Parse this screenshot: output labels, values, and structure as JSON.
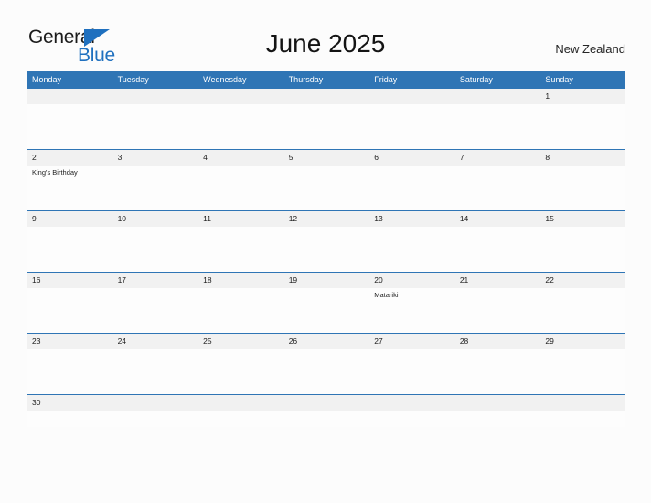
{
  "brand": {
    "word_primary": "General",
    "word_secondary": "Blue",
    "flag_icon": "blue-flag-triangle",
    "primary_color": "#1b1b1b",
    "secondary_color": "#1f70bf"
  },
  "header": {
    "title": "June 2025",
    "region": "New Zealand",
    "accent_color": "#2f75b5"
  },
  "calendar": {
    "month": "June",
    "year": "2025",
    "weekday_headers": [
      "Monday",
      "Tuesday",
      "Wednesday",
      "Thursday",
      "Friday",
      "Saturday",
      "Sunday"
    ],
    "header_background": "#2f75b5",
    "number_band_background": "#f1f1f1",
    "weeks": [
      {
        "days": [
          {
            "number": "",
            "events": []
          },
          {
            "number": "",
            "events": []
          },
          {
            "number": "",
            "events": []
          },
          {
            "number": "",
            "events": []
          },
          {
            "number": "",
            "events": []
          },
          {
            "number": "",
            "events": []
          },
          {
            "number": "1",
            "events": []
          }
        ]
      },
      {
        "days": [
          {
            "number": "2",
            "events": [
              "King's Birthday"
            ]
          },
          {
            "number": "3",
            "events": []
          },
          {
            "number": "4",
            "events": []
          },
          {
            "number": "5",
            "events": []
          },
          {
            "number": "6",
            "events": []
          },
          {
            "number": "7",
            "events": []
          },
          {
            "number": "8",
            "events": []
          }
        ]
      },
      {
        "days": [
          {
            "number": "9",
            "events": []
          },
          {
            "number": "10",
            "events": []
          },
          {
            "number": "11",
            "events": []
          },
          {
            "number": "12",
            "events": []
          },
          {
            "number": "13",
            "events": []
          },
          {
            "number": "14",
            "events": []
          },
          {
            "number": "15",
            "events": []
          }
        ]
      },
      {
        "days": [
          {
            "number": "16",
            "events": []
          },
          {
            "number": "17",
            "events": []
          },
          {
            "number": "18",
            "events": []
          },
          {
            "number": "19",
            "events": []
          },
          {
            "number": "20",
            "events": [
              "Matariki"
            ]
          },
          {
            "number": "21",
            "events": []
          },
          {
            "number": "22",
            "events": []
          }
        ]
      },
      {
        "days": [
          {
            "number": "23",
            "events": []
          },
          {
            "number": "24",
            "events": []
          },
          {
            "number": "25",
            "events": []
          },
          {
            "number": "26",
            "events": []
          },
          {
            "number": "27",
            "events": []
          },
          {
            "number": "28",
            "events": []
          },
          {
            "number": "29",
            "events": []
          }
        ]
      },
      {
        "days": [
          {
            "number": "30",
            "events": []
          },
          {
            "number": "",
            "events": []
          },
          {
            "number": "",
            "events": []
          },
          {
            "number": "",
            "events": []
          },
          {
            "number": "",
            "events": []
          },
          {
            "number": "",
            "events": []
          },
          {
            "number": "",
            "events": []
          }
        ]
      }
    ]
  }
}
